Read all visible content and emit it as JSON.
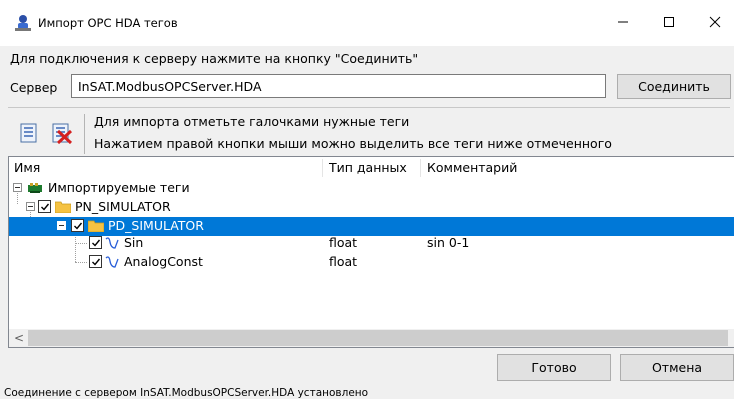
{
  "window": {
    "title": "Импорт OPC HDA тегов",
    "minimize_icon": "minimize-icon",
    "maximize_icon": "maximize-icon",
    "close_icon": "close-icon"
  },
  "connection": {
    "hint": "Для подключения к серверу нажмите на кнопку \"Соединить\"",
    "server_label": "Сервер",
    "server_value": "InSAT.ModbusOPCServer.HDA",
    "connect_label": "Соединить"
  },
  "toolbar": {
    "check_all_icon": "check-all-icon",
    "uncheck_all_icon": "uncheck-all-icon",
    "hint_line1": "Для импорта отметьте галочками нужные теги",
    "hint_line2": "Нажатием правой кнопки мыши можно выделить все теги ниже отмеченного"
  },
  "tree": {
    "columns": [
      "Имя",
      "Тип данных",
      "Комментарий"
    ],
    "root": {
      "label": "Импортируемые теги",
      "icon": "tags-root-icon"
    },
    "nodes": [
      {
        "label": "PN_SIMULATOR",
        "type": "",
        "comment": "",
        "checked": true,
        "icon": "folder-icon"
      },
      {
        "label": "PD_SIMULATOR",
        "type": "",
        "comment": "",
        "checked": true,
        "icon": "folder-icon",
        "selected": true
      },
      {
        "label": "Sin",
        "type": "float",
        "comment": "sin 0-1",
        "checked": true,
        "icon": "signal-wave-icon"
      },
      {
        "label": "AnalogConst",
        "type": "float",
        "comment": "",
        "checked": true,
        "icon": "signal-wave-icon"
      }
    ]
  },
  "scrollbar": {
    "left_arrow": "<"
  },
  "buttons": {
    "done": "Готово",
    "cancel": "Отмена"
  },
  "status": {
    "text": "Соединение с сервером InSAT.ModbusOPCServer.HDA установлено"
  },
  "colors": {
    "selection": "#0078d7",
    "folder": "#f5c242",
    "wave": "#2a5fd8",
    "root_icon": "#1e7a2e"
  }
}
